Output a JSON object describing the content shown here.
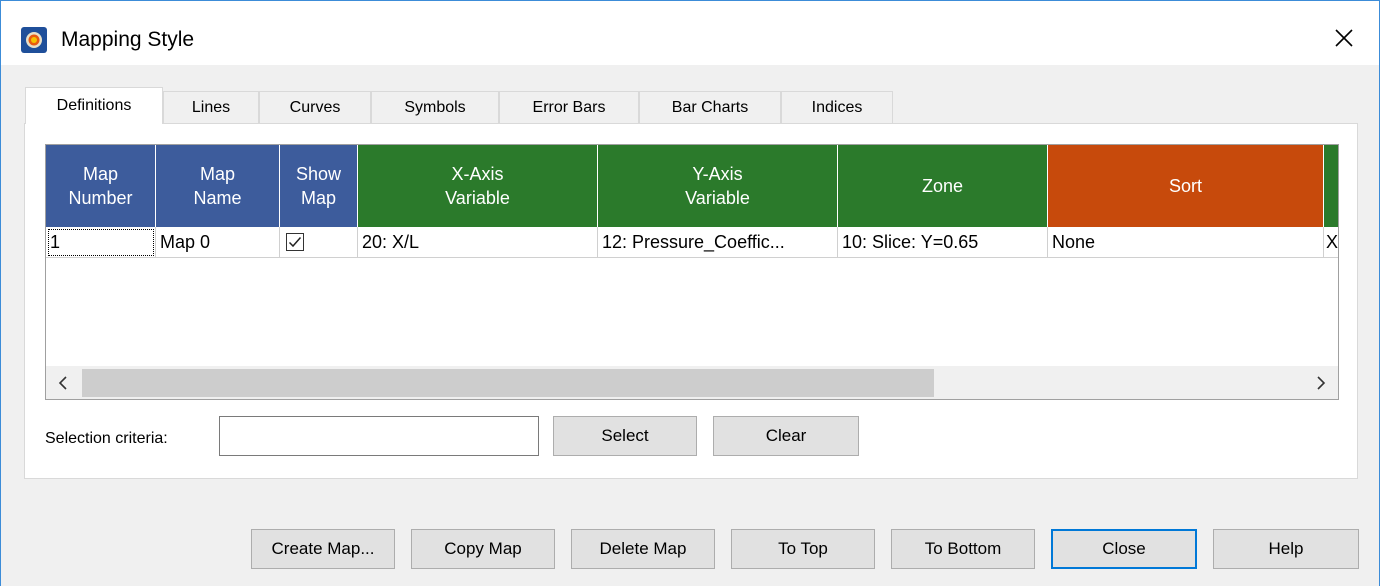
{
  "window": {
    "title": "Mapping Style",
    "app_icon": "tecplot-app-icon",
    "close_symbol": "✕"
  },
  "tabs": [
    {
      "label": "Definitions",
      "active": true
    },
    {
      "label": "Lines",
      "active": false
    },
    {
      "label": "Curves",
      "active": false
    },
    {
      "label": "Symbols",
      "active": false
    },
    {
      "label": "Error Bars",
      "active": false
    },
    {
      "label": "Bar Charts",
      "active": false
    },
    {
      "label": "Indices",
      "active": false
    }
  ],
  "grid": {
    "columns": [
      {
        "label": "Map\nNumber",
        "color": "#3d5c9c"
      },
      {
        "label": "Map\nName",
        "color": "#3d5c9c"
      },
      {
        "label": "Show\nMap",
        "color": "#3d5c9c"
      },
      {
        "label": "X-Axis\nVariable",
        "color": "#2b7a2b"
      },
      {
        "label": "Y-Axis\nVariable",
        "color": "#2b7a2b"
      },
      {
        "label": "Zone",
        "color": "#2b7a2b"
      },
      {
        "label": "Sort",
        "color": "#c74a0c"
      }
    ],
    "rows": [
      {
        "map_number": "1",
        "map_name": "Map 0",
        "show_map": true,
        "x_var": "20: X/L",
        "y_var": "12: Pressure_Coeffic...",
        "zone": "10: Slice: Y=0.65",
        "sort": "None",
        "next_col_partial": "X"
      }
    ],
    "scroll_left_symbol": "<",
    "scroll_right_symbol": ">"
  },
  "selection": {
    "label": "Selection criteria:",
    "value": "",
    "select_label": "Select",
    "clear_label": "Clear"
  },
  "buttons": {
    "create_map": "Create Map...",
    "copy_map": "Copy Map",
    "delete_map": "Delete Map",
    "to_top": "To Top",
    "to_bottom": "To Bottom",
    "close": "Close",
    "help": "Help"
  }
}
